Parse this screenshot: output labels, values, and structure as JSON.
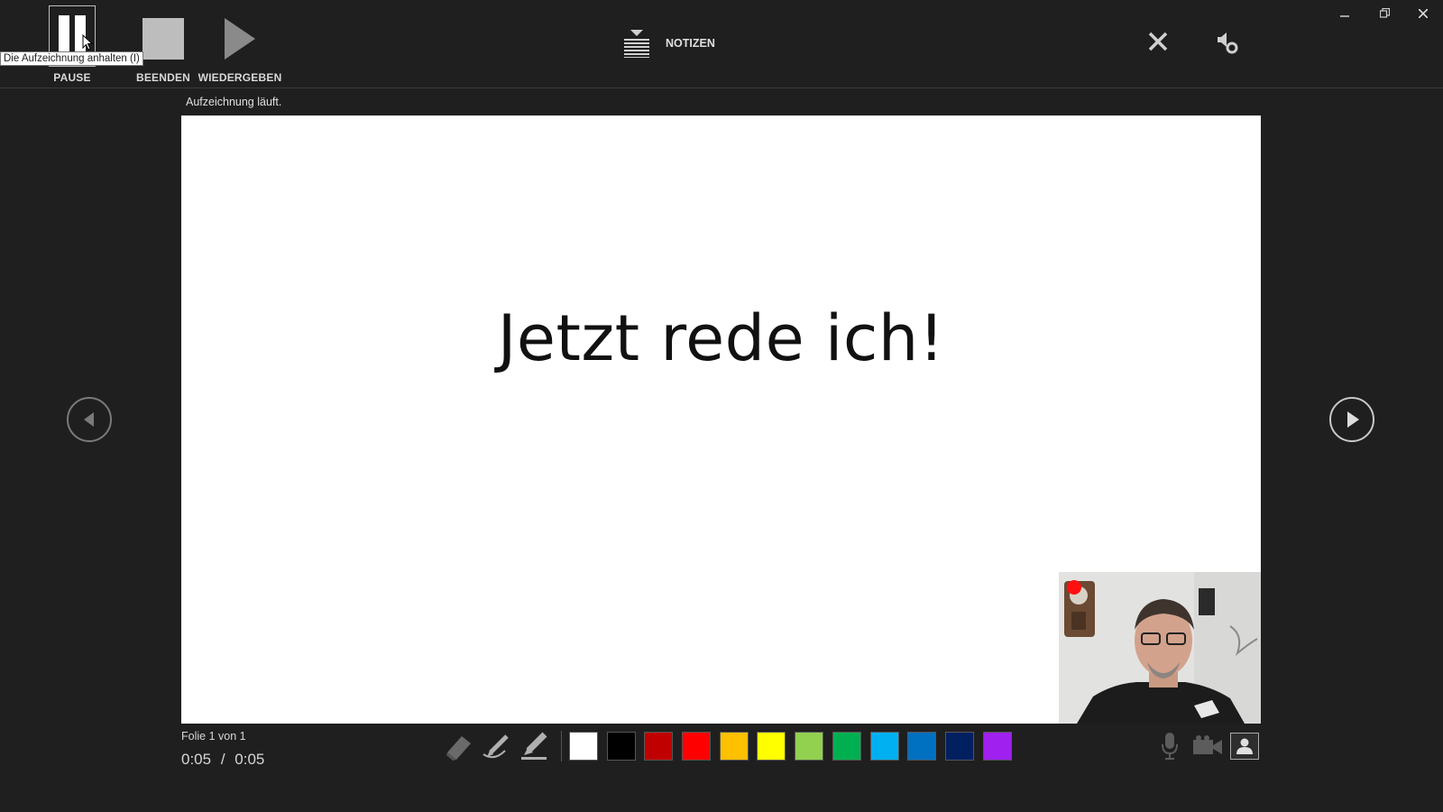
{
  "toolbar": {
    "pause_label": "PAUSE",
    "stop_label": "BEENDEN",
    "play_label": "WIEDERGEBEN",
    "notes_label": "NOTIZEN"
  },
  "tooltip": {
    "text": "Die Aufzeichnung anhalten (I)"
  },
  "status": {
    "text": "Aufzeichnung läuft."
  },
  "slide": {
    "title": "Jetzt rede ich!"
  },
  "footer": {
    "slide_counter": "Folie 1 von 1",
    "elapsed": "0:05",
    "separator": "/",
    "total": "0:05"
  },
  "ink_colors": [
    "#ffffff",
    "#000000",
    "#c00000",
    "#ff0000",
    "#ffc000",
    "#ffff00",
    "#92d050",
    "#00b050",
    "#00b0f0",
    "#0070c0",
    "#002060",
    "#a020f0"
  ],
  "icons": {
    "toolbar": [
      "pause-icon",
      "stop-icon",
      "play-icon",
      "notes-icon",
      "close-icon",
      "settings-icon"
    ],
    "tools": [
      "eraser-icon",
      "pen-icon",
      "highlighter-icon"
    ],
    "bottom_right": [
      "microphone-icon",
      "video-camera-icon",
      "camera-preview-icon"
    ],
    "nav": [
      "previous-slide-icon",
      "next-slide-icon"
    ]
  },
  "accent": {
    "recording": "#ff1010",
    "background": "#1f1f1f"
  }
}
